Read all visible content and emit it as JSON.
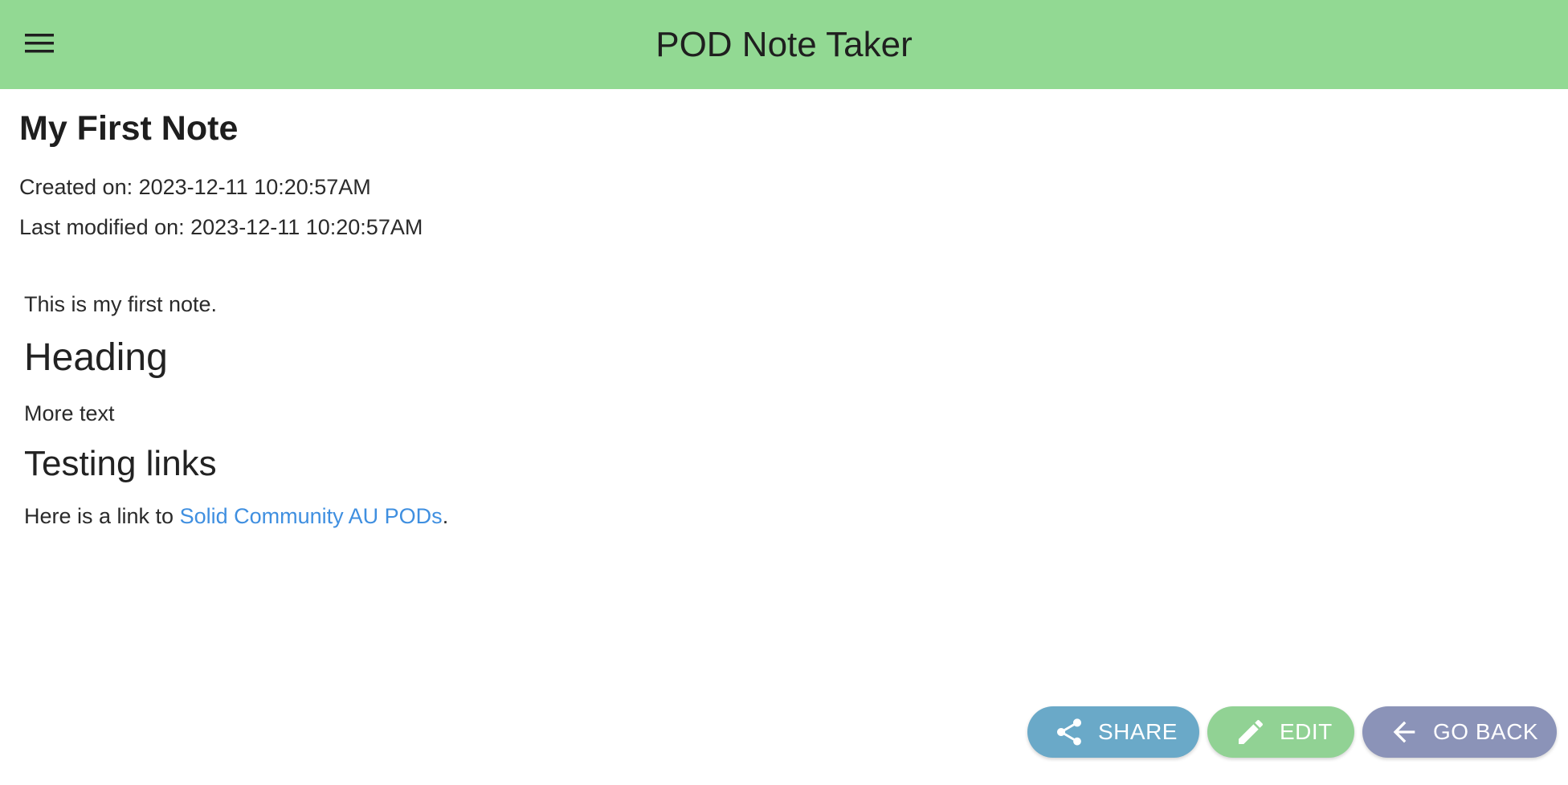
{
  "appbar": {
    "title": "POD Note Taker",
    "menu_icon": "hamburger-menu-icon",
    "background": "#92d993"
  },
  "note": {
    "title": "My First Note",
    "created": "Created on: 2023-12-11 10:20:57AM",
    "modified": "Last modified on: 2023-12-11 10:20:57AM",
    "content": {
      "paragraph1": "This is my first note.",
      "heading1": "Heading",
      "paragraph2": "More text",
      "heading2": "Testing links",
      "paragraph3_prefix": "Here is a link to ",
      "link_text": "Solid Community AU PODs",
      "paragraph3_suffix": "."
    }
  },
  "actions": {
    "share": {
      "label": "SHARE",
      "icon": "share-icon",
      "color": "#6aa9c8"
    },
    "edit": {
      "label": "EDIT",
      "icon": "pencil-icon",
      "color": "#91d294"
    },
    "back": {
      "label": "GO BACK",
      "icon": "arrow-left-icon",
      "color": "#8b93b8"
    }
  },
  "colors": {
    "link": "#3f8fe0"
  }
}
